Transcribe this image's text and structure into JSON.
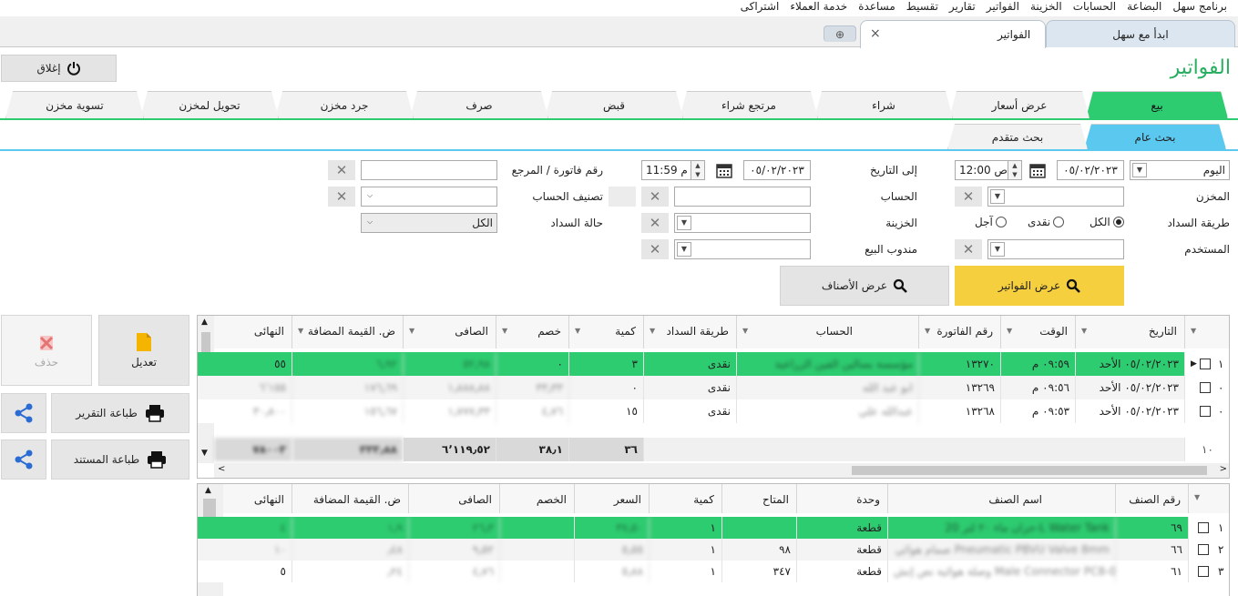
{
  "menu": [
    "برنامج سهل",
    "البضاعة",
    "الحسابات",
    "الخزينة",
    "الفواتير",
    "تقارير",
    "تقسيط",
    "مساعدة",
    "خدمة العملاء",
    "اشتراكى"
  ],
  "doc_tabs": {
    "home": "ابدأ مع سهل",
    "invoices": "الفواتير",
    "close_glyph": "×",
    "add_glyph": "⊕"
  },
  "page_title": "الفواتير",
  "close_button": "إغلاق",
  "op_tabs": [
    "بيع",
    "عرض أسعار",
    "شراء",
    "مرتجع شراء",
    "قبض",
    "صرف",
    "جرد مخزن",
    "تحويل لمخزن",
    "تسوية مخزن"
  ],
  "search_tabs": {
    "general": "بحث عام",
    "advanced": "بحث متقدم"
  },
  "filters": {
    "period": "اليوم",
    "from_date": "٠٥/٠٢/٢٠٢٣",
    "from_time": "12:00",
    "from_ampm": "ص",
    "to_label": "إلى التاريخ",
    "to_date": "٠٥/٠٢/٢٠٢٣",
    "to_time": "11:59",
    "to_ampm": "م",
    "invoice_ref_label": "رقم فاتورة / المرجع",
    "warehouse_label": "المخزن",
    "account_label": "الحساب",
    "account_class_label": "تصنيف الحساب",
    "payment_method_label": "طريقة السداد",
    "payment_all": "الكل",
    "payment_cash": "نقدى",
    "payment_credit": "آجل",
    "treasury_label": "الخزينة",
    "payment_status_label": "حالة السداد",
    "payment_status_value": "الكل",
    "user_label": "المستخدم",
    "sales_rep_label": "مندوب البيع"
  },
  "actions": {
    "show_invoices": "عرض الفواتير",
    "show_items": "عرض الأصناف"
  },
  "side_buttons": {
    "edit": "تعديل",
    "delete": "حذف",
    "print_report": "طباعة التقرير",
    "print_document": "طباعة المستند"
  },
  "invoices_table": {
    "headers": [
      "التاريخ",
      "الوقت",
      "رقم الفاتورة",
      "الحساب",
      "طريقة السداد",
      "كمية",
      "خصم",
      "الصافى",
      "ض. القيمة المضافة",
      "النهائى"
    ],
    "rows": [
      {
        "idx": "١",
        "date": "٠٥/٠٢/٢٠٢٣ الأحد",
        "time": "٠٩:٥٩ م",
        "no": "١٣٢٧٠",
        "account": "مؤسسة بسالين الفين الزراعية",
        "pay": "نقدى",
        "qty": "٣",
        "disc": "٠",
        "net": "٥٢٫٩٨",
        "vat": "٦٫٩٢",
        "final": "٥٥"
      },
      {
        "idx": "٠",
        "date": "٠٥/٠٢/٢٠٢٣ الأحد",
        "time": "٠٩:٥٦ م",
        "no": "١٣٢٦٩",
        "account": "ابو عبد الله",
        "pay": "نقدى",
        "qty": "٠",
        "disc": "٣٣٫٣٣",
        "net": "١٫٨٨٨٫٨٨",
        "vat": "١٧٦٫٦٩",
        "final": "٦٬١٥٥"
      },
      {
        "idx": "٠",
        "date": "٠٥/٠٢/٢٠٢٣ الأحد",
        "time": "٠٩:٥٣ م",
        "no": "١٣٢٦٨",
        "account": "عبدالله علي",
        "pay": "نقدى",
        "qty": "١٥",
        "disc": "٤٫٧٦",
        "net": "١٫٧٧٧٫٣٣",
        "vat": "١٥٦٫٦٧",
        "final": "٣٠٫٨٠٠"
      }
    ],
    "footer": {
      "idx": "١٠",
      "qty": "٣٦",
      "disc": "٣٨٫١",
      "net": "٦٬١١٩٫٥٢",
      "vat": "٣٣٣٫٨٨",
      "final": "٧٨٠٠٣"
    }
  },
  "items_table": {
    "headers": [
      "رقم الصنف",
      "اسم الصنف",
      "وحدة",
      "المتاح",
      "كمية",
      "السعر",
      "الخصم",
      "الصافى",
      "ض. القيمة المضافة",
      "النهائى"
    ],
    "rows": [
      {
        "idx": "١",
        "code": "٦٩",
        "name": "خزان ماء ٢٠ لتر 20-L Water Tank",
        "unit": "قطعة",
        "avail": "",
        "qty": "١",
        "price": "٣٧٫٥٠",
        "disc": "",
        "net": "٢٦٫٣",
        "vat": "١٫٩",
        "final": "٤"
      },
      {
        "idx": "٢",
        "code": "٦٦",
        "name": "صمام هوائي Pneumatic PBVU Valve 8mm",
        "unit": "قطعة",
        "avail": "٩٨",
        "qty": "١",
        "price": "٥٫٥٥",
        "disc": "",
        "net": "٩٫٥٢",
        "vat": "٫٤٨",
        "final": "١٠"
      },
      {
        "idx": "٣",
        "code": "٦١",
        "name": "وصلة هوائية نص إنش Male Connector PC8-04",
        "unit": "قطعة",
        "avail": "٣٤٧",
        "qty": "١",
        "price": "٥٫٨٨",
        "disc": "",
        "net": "٤٫٧٦",
        "vat": "٫٢٤",
        "final": "٥"
      }
    ]
  },
  "colors": {
    "green": "#2ecc71",
    "blue": "#5bc8f0",
    "yellow": "#f5cf3e"
  }
}
